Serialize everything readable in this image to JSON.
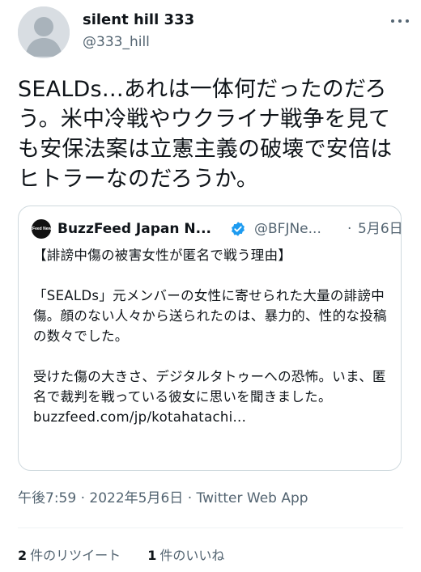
{
  "author": {
    "display_name": "silent hill 333",
    "handle": "@333_hill"
  },
  "tweet": {
    "text": "SEALDs…あれは一体何だったのだろう。米中冷戦やウクライナ戦争を見ても安保法案は立憲主義の破壊で安倍はヒトラーなのだろうか。"
  },
  "quote": {
    "avatar_text": "BuzzFeed News JP",
    "display_name": "BuzzFeed Japan N...",
    "handle": "@BFJNe...",
    "separator": "·",
    "date": "5月6日",
    "headline": "【誹謗中傷の被害女性が匿名で戦う理由】",
    "paragraph1": "「SEALDs」元メンバーの女性に寄せられた大量の誹謗中傷。顔のない人々から送られたのは、暴力的、性的な投稿の数々でした。",
    "paragraph2": "受けた傷の大きさ、デジタルタトゥーへの恐怖。いま、匿名で裁判を戦っている彼女に思いを聞きました。",
    "link": "buzzfeed.com/jp/kotahatachi..."
  },
  "meta": {
    "time": "午後7:59",
    "sep1": " · ",
    "date": "2022年5月6日",
    "sep2": " · ",
    "source": "Twitter Web App"
  },
  "stats": {
    "retweets_count": "2",
    "retweets_label": "件のリツイート",
    "likes_count": "1",
    "likes_label": "件のいいね"
  },
  "colors": {
    "text": "#0f1419",
    "secondary": "#536471",
    "border": "#cfd9de",
    "verified": "#1d9bf0"
  },
  "icons": [
    "avatar-placeholder-icon",
    "more-options-icon",
    "verified-badge-icon"
  ]
}
